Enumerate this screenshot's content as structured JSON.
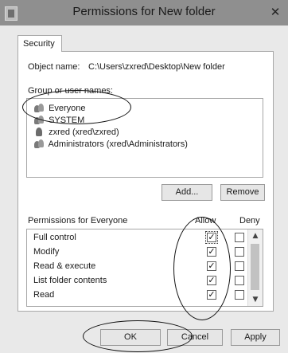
{
  "window": {
    "title": "Permissions for New folder",
    "close_glyph": "✕"
  },
  "tabs": [
    {
      "label": "Security"
    }
  ],
  "object": {
    "label": "Object name:",
    "value": "C:\\Users\\zxred\\Desktop\\New folder"
  },
  "group": {
    "label": "Group or user names:",
    "principals": [
      {
        "name": "Everyone",
        "icon": "users-icon"
      },
      {
        "name": "SYSTEM",
        "icon": "users-icon"
      },
      {
        "name": "zxred (xred\\zxred)",
        "icon": "user-icon"
      },
      {
        "name": "Administrators (xred\\Administrators)",
        "icon": "users-icon"
      }
    ],
    "add_label": "Add...",
    "remove_label": "Remove"
  },
  "permissions": {
    "header": "Permissions for Everyone",
    "allow_label": "Allow",
    "deny_label": "Deny",
    "check_glyph": "✓",
    "scroll_up_glyph": "▲",
    "scroll_down_glyph": "▼",
    "rows": [
      {
        "name": "Full control",
        "allow": true,
        "deny": false
      },
      {
        "name": "Modify",
        "allow": true,
        "deny": false
      },
      {
        "name": "Read & execute",
        "allow": true,
        "deny": false
      },
      {
        "name": "List folder contents",
        "allow": true,
        "deny": false
      },
      {
        "name": "Read",
        "allow": true,
        "deny": false
      }
    ]
  },
  "footer": {
    "ok_label": "OK",
    "cancel_label": "Cancel",
    "apply_label": "Apply"
  }
}
